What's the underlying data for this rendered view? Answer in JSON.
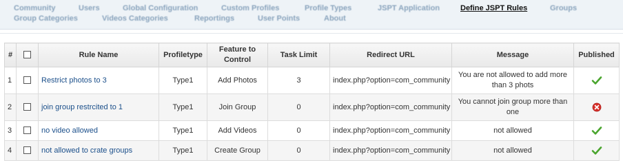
{
  "submenu": {
    "row1": [
      "Community",
      "Users",
      "Global Configuration",
      "Custom Profiles",
      "Profile Types",
      "JSPT Application",
      "Define JSPT Rules",
      "Groups"
    ],
    "row2": [
      "Group Categories",
      "Videos Categories",
      "Reportings",
      "User Points",
      "About"
    ],
    "active": "Define JSPT Rules"
  },
  "table": {
    "headers": {
      "num": "#",
      "rule_name": "Rule Name",
      "profiletype": "Profiletype",
      "feature": "Feature to Control",
      "task_limit": "Task Limit",
      "redirect_url": "Redirect URL",
      "message": "Message",
      "published": "Published"
    },
    "rows": [
      {
        "num": "1",
        "rule_name": "Restrict photos to 3",
        "profiletype": "Type1",
        "feature": "Add Photos",
        "task_limit": "3",
        "redirect_url": "index.php?option=com_community",
        "message": "You are not allowed to add more than 3 phots",
        "published": true
      },
      {
        "num": "2",
        "rule_name": "join group restrcited to 1",
        "profiletype": "Type1",
        "feature": "Join Group",
        "task_limit": "0",
        "redirect_url": "index.php?option=com_community",
        "message": "You cannot join group more than one",
        "published": false
      },
      {
        "num": "3",
        "rule_name": "no video allowed",
        "profiletype": "Type1",
        "feature": "Add Videos",
        "task_limit": "0",
        "redirect_url": "index.php?option=com_community",
        "message": "not allowed",
        "published": true
      },
      {
        "num": "4",
        "rule_name": "not allowed to crate groups",
        "profiletype": "Type1",
        "feature": "Create Group",
        "task_limit": "0",
        "redirect_url": "index.php?option=com_community",
        "message": "not allowed",
        "published": true
      }
    ]
  },
  "colors": {
    "published": "#4aa52e",
    "unpublished": "#d8302a",
    "link": "#1b4f8a"
  },
  "icons": {
    "published": "check-icon",
    "unpublished": "unpublished-x-icon"
  }
}
